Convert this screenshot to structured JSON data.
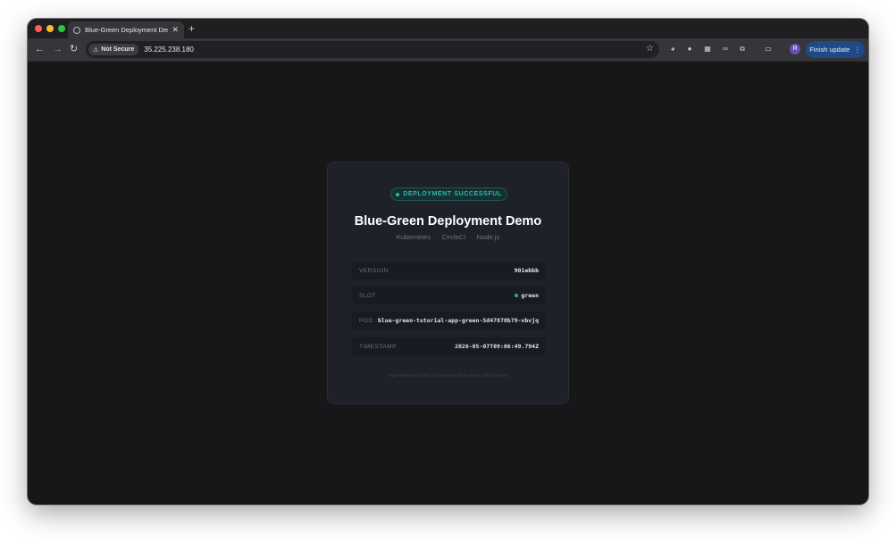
{
  "browser": {
    "tab_title": "Blue-Green Deployment Dem",
    "new_tab": "+",
    "not_secure_label": "Not Secure",
    "url": "35.225.238.180",
    "profile_initial": "R",
    "finish_update_label": "Finish update"
  },
  "card": {
    "status_badge": "DEPLOYMENT SUCCESSFUL",
    "title": "Blue-Green Deployment Demo",
    "stack": [
      "Kubernetes",
      "CircleCI",
      "Node.js"
    ],
    "rows": [
      {
        "label": "VERSION",
        "value": "901ebbb"
      },
      {
        "label": "SLOT",
        "value": "green"
      },
      {
        "label": "POD",
        "value": "blue-green-tutorial-app-green-5d47878b79-vbvjq"
      },
      {
        "label": "TIMESTAMP",
        "value": "2026-05-07T09:06:49.794Z"
      }
    ],
    "footer": "rogerwinters/circleci-kubernetes-blue-green-deployment"
  },
  "colors": {
    "accent_teal": "#2fb7b0",
    "slot_green": "#2bb673",
    "finish_button": "#1f4a86"
  }
}
